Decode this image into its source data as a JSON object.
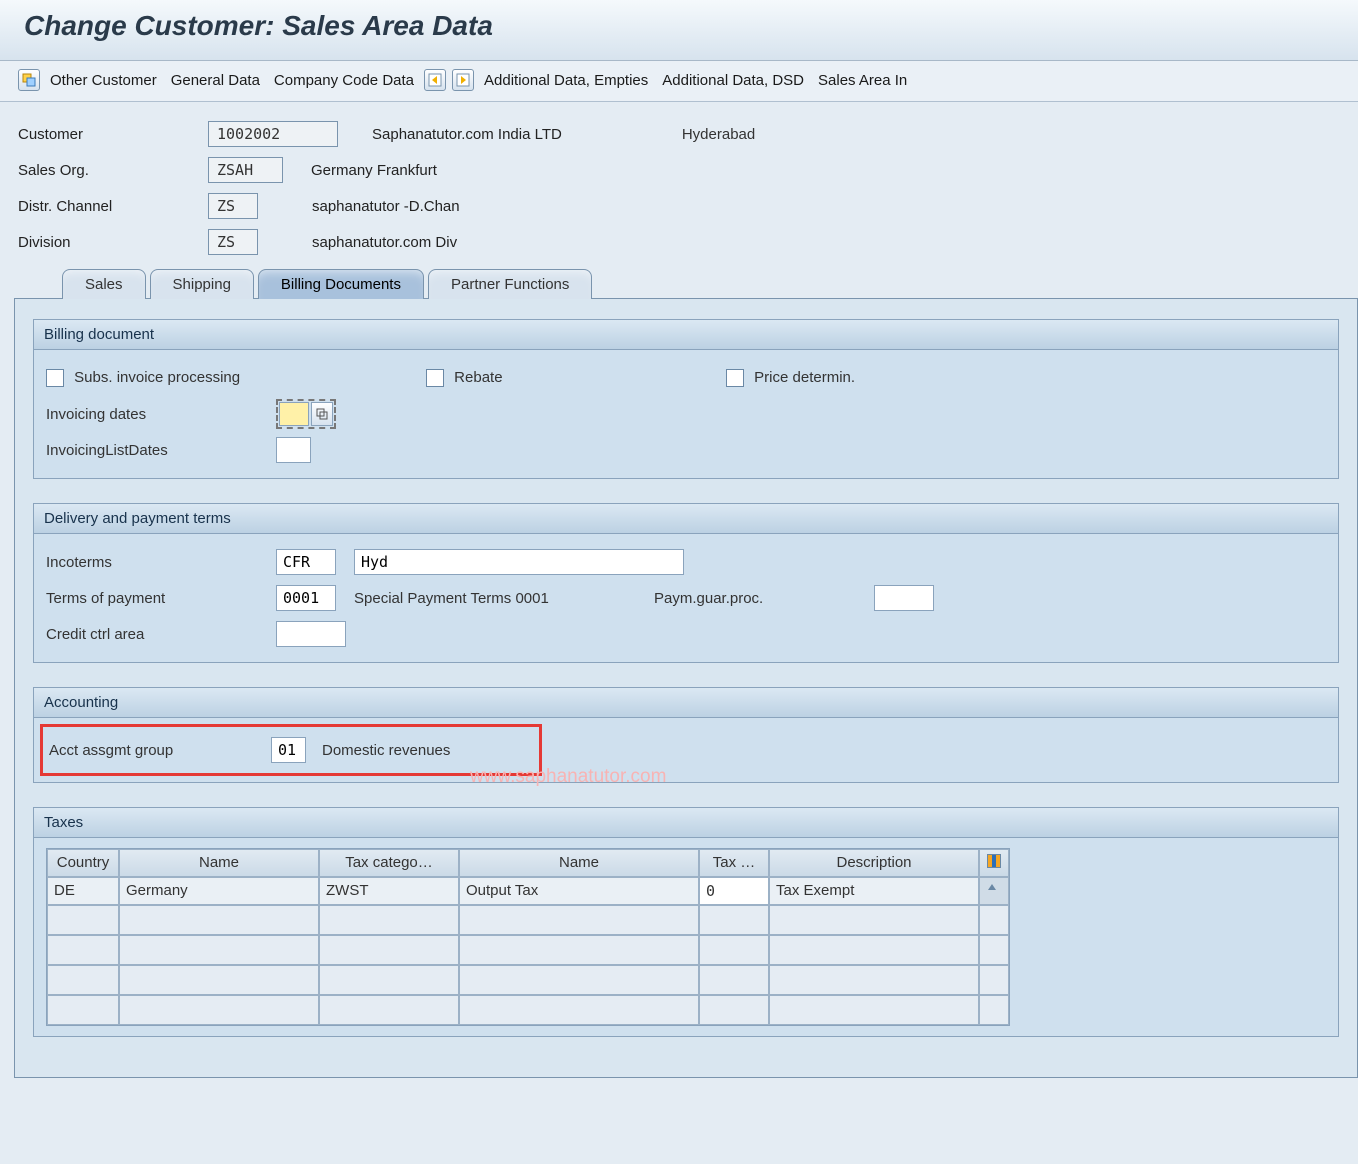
{
  "title": "Change Customer: Sales Area Data",
  "toolbar": {
    "other_customer": "Other Customer",
    "general_data": "General Data",
    "company_code_data": "Company Code Data",
    "additional_data_empties": "Additional Data, Empties",
    "additional_data_dsd": "Additional Data, DSD",
    "sales_area_in": "Sales Area In"
  },
  "header": {
    "customer_label": "Customer",
    "customer_value": "1002002",
    "customer_name": "Saphanatutor.com  India LTD",
    "customer_city": "Hyderabad",
    "sales_org_label": "Sales Org.",
    "sales_org_value": "ZSAH",
    "sales_org_text": "Germany Frankfurt",
    "distr_channel_label": "Distr. Channel",
    "distr_channel_value": "ZS",
    "distr_channel_text": "saphanatutor -D.Chan",
    "division_label": "Division",
    "division_value": "ZS",
    "division_text": "saphanatutor.com Div"
  },
  "tabs": {
    "sales": "Sales",
    "shipping": "Shipping",
    "billing": "Billing Documents",
    "partner": "Partner Functions"
  },
  "billing_doc": {
    "group_title": "Billing document",
    "subs_invoice": "Subs. invoice processing",
    "rebate": "Rebate",
    "price_determ": "Price determin.",
    "invoicing_dates": "Invoicing dates",
    "invoicing_list_dates": "InvoicingListDates"
  },
  "delivery_terms": {
    "group_title": "Delivery and payment terms",
    "incoterms": "Incoterms",
    "incoterms_val1": "CFR",
    "incoterms_val2": "Hyd",
    "terms_of_payment": "Terms of payment",
    "terms_of_payment_val": "0001",
    "terms_of_payment_text": "Special Payment Terms 0001",
    "paym_guar_proc": "Paym.guar.proc.",
    "credit_ctrl_area": "Credit ctrl area"
  },
  "accounting": {
    "group_title": "Accounting",
    "acct_assgmt_group": "Acct assgmt group",
    "acct_assgmt_val": "01",
    "acct_assgmt_text": "Domestic revenues"
  },
  "taxes": {
    "group_title": "Taxes",
    "columns": {
      "country": "Country",
      "name1": "Name",
      "tax_cat": "Tax catego…",
      "name2": "Name",
      "tax_cl": "Tax …",
      "description": "Description"
    },
    "row": {
      "country": "DE",
      "name1": "Germany",
      "tax_cat": "ZWST",
      "name2": "Output Tax",
      "tax_cl": "0",
      "description": "Tax Exempt"
    }
  },
  "watermark": "www.saphanatutor.com"
}
